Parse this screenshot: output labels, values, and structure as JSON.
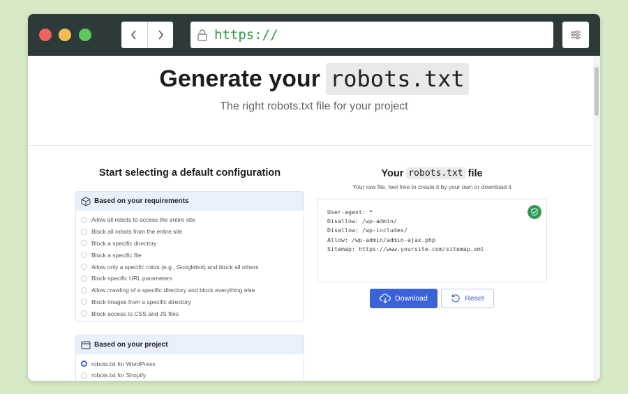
{
  "browser": {
    "url": "https://"
  },
  "hero": {
    "title_prefix": "Generate your",
    "title_code": "robots.txt",
    "subtitle": "The right robots.txt file for your project"
  },
  "left": {
    "heading": "Start selecting a default configuration",
    "requirements": {
      "title": "Based on your requirements",
      "options": [
        "Allow all robots to access the entire site",
        "Block all robots from the entire site",
        "Block a specific directory",
        "Block a specific file",
        "Allow only a specific robot (e.g., Googlebot) and block all others",
        "Block specific URL parameters",
        "Allow crawling of a specific directory and block everything else",
        "Block images from a specific directory",
        "Block access to CSS and JS files"
      ]
    },
    "project": {
      "title": "Based on your project",
      "options": [
        "robots.txt for WordPress",
        "robots.txt for Shopify"
      ],
      "selected": "robots.txt for WordPress"
    }
  },
  "right": {
    "heading_prefix": "Your",
    "heading_code": "robots.txt",
    "heading_suffix": "file",
    "subtitle": "Your raw file, feel free to create it by your own or download it",
    "content": "User-agent: *\nDisallow: /wp-admin/\nDisallow: /wp-includes/\nAllow: /wp-admin/admin-ajax.php\nSitemap: https://www.yoursite.com/sitemap.xml",
    "download_label": "Download",
    "reset_label": "Reset"
  },
  "colors": {
    "background": "#d6eac6",
    "chrome": "#2d3a3a",
    "accent": "#3b63d8",
    "url": "#2b9a3c",
    "valid": "#2e9a54"
  },
  "icons": {
    "requirements": "box-icon",
    "project": "browser-window-icon",
    "valid": "shield-check-icon",
    "download": "cloud-download-icon",
    "reset": "reset-icon"
  }
}
